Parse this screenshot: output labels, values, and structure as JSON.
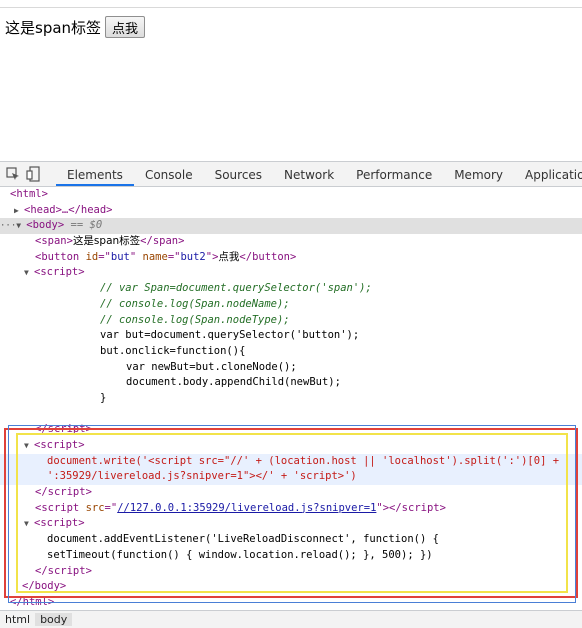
{
  "page": {
    "span_text": "这是span标签",
    "button_label": "点我"
  },
  "devtools": {
    "tabs": [
      "Elements",
      "Console",
      "Sources",
      "Network",
      "Performance",
      "Memory",
      "Application"
    ],
    "active_tab": "Elements"
  },
  "dom": {
    "html_open": "<html>",
    "head": "<head>…</head>",
    "body_open": "<body>",
    "body_marker": "== $0",
    "span_text": "这是span标签",
    "button_text": "点我",
    "button_id": "but",
    "button_name": "but2",
    "comment1": "// var Span=document.querySelector('span');",
    "comment2": "// console.log(Span.nodeName);",
    "comment3": "// console.log(Span.nodeType);",
    "line_var": "var but=document.querySelector('button');",
    "line_onclick": "but.onclick=function(){",
    "line_newbut": "var newBut=but.cloneNode();",
    "line_append": "document.body.appendChild(newBut);",
    "line_close": "}",
    "dw_line1": "document.write('<script src=\"//' + (location.host || 'localhost').split(':')[0] +",
    "dw_line2": "':35929/livereload.js?snipver=1\"></' + 'script>')",
    "livereload_src": "//127.0.0.1:35929/livereload.js?snipver=1",
    "listener_line1": "document.addEventListener('LiveReloadDisconnect', function() {",
    "listener_line2": "setTimeout(function() { window.location.reload(); }, 500); })"
  },
  "breadcrumbs": [
    "html",
    "body"
  ],
  "colors": {
    "red_box": "#e0413a",
    "blue_box": "#4a7fd6",
    "yellow_box": "#f2e34a",
    "active_tab_underline": "#1a73e8"
  }
}
